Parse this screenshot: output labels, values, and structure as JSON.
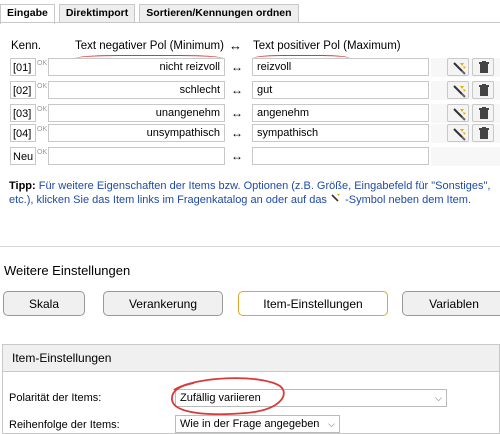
{
  "tabs": [
    {
      "label": "Eingabe",
      "active": true
    },
    {
      "label": "Direktimport",
      "active": false
    },
    {
      "label": "Sortieren/Kennungen ordnen",
      "active": false
    }
  ],
  "table": {
    "col_kenn": "Kenn.",
    "col_negative": "Text negativer Pol (Minimum)",
    "arrow": "↔",
    "col_positive": "Text positiver Pol (Maximum)",
    "rows": [
      {
        "kenn": "[01]",
        "negative": "nicht reizvoll",
        "positive": "reizvoll"
      },
      {
        "kenn": "[02]",
        "negative": "schlecht",
        "positive": "gut"
      },
      {
        "kenn": "[03]",
        "negative": "unangenehm",
        "positive": "angenehm"
      },
      {
        "kenn": "[04]",
        "negative": "unsympathisch",
        "positive": "sympathisch"
      }
    ],
    "new_row": {
      "kenn": "Neu",
      "negative": "",
      "positive": ""
    },
    "ok_glyph": "OK"
  },
  "tipp": {
    "label": "Tipp:",
    "text_a": "Für weitere Eigenschaften der Items bzw. Optionen (z.B. Größe, Eingabefeld für \"Sonstiges\", etc.), klicken Sie das Item links im Fragenkatalog an oder auf das",
    "text_b": "-Symbol neben dem Item."
  },
  "weitere": {
    "title": "Weitere Einstellungen",
    "buttons": [
      {
        "label": "Skala",
        "active": false
      },
      {
        "label": "Verankerung",
        "active": false
      },
      {
        "label": "Item-Einstellungen",
        "active": true
      },
      {
        "label": "Variablen",
        "active": false
      }
    ]
  },
  "item_settings": {
    "title": "Item-Einstellungen",
    "polaritaet_label": "Polarität der Items:",
    "polaritaet_value": "Zufällig variieren",
    "reihenfolge_label": "Reihenfolge der Items:",
    "reihenfolge_value": "Wie in der Frage angegeben"
  },
  "colors": {
    "annotation": "#d83a3a",
    "tipp_text": "#1f4aa8",
    "active_border": "#e0a52e"
  }
}
